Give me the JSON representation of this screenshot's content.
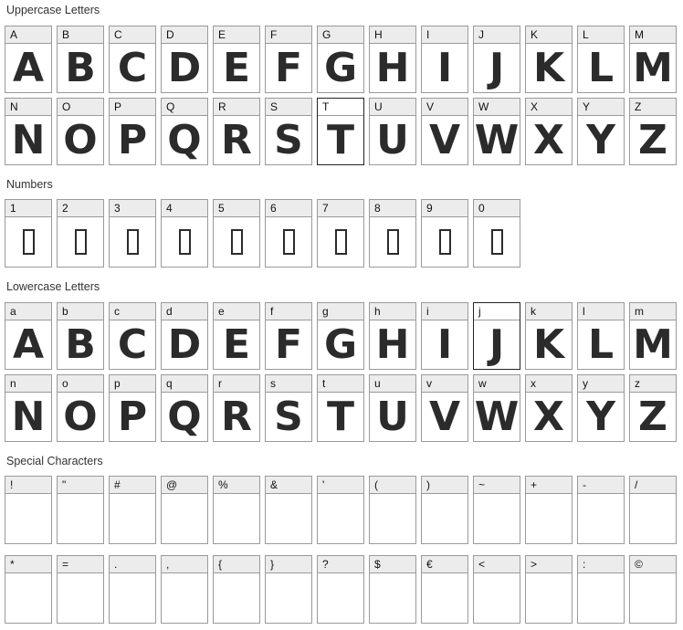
{
  "sections": [
    {
      "title": "Uppercase Letters",
      "rows": [
        [
          "A",
          "B",
          "C",
          "D",
          "E",
          "F",
          "G",
          "H",
          "I",
          "J",
          "K",
          "L",
          "M"
        ],
        [
          "N",
          "O",
          "P",
          "Q",
          "R",
          "S",
          "T",
          "U",
          "V",
          "W",
          "X",
          "Y",
          "Z"
        ]
      ],
      "glyphs": [
        [
          "A",
          "B",
          "C",
          "D",
          "E",
          "F",
          "G",
          "H",
          "I",
          "J",
          "K",
          "L",
          "M"
        ],
        [
          "N",
          "O",
          "P",
          "Q",
          "R",
          "S",
          "T",
          "U",
          "V",
          "W",
          "X",
          "Y",
          "Z"
        ]
      ],
      "focus": "T"
    },
    {
      "title": "Numbers",
      "rows": [
        [
          "1",
          "2",
          "3",
          "4",
          "5",
          "6",
          "7",
          "8",
          "9",
          "0"
        ]
      ],
      "glyphs": "notdef"
    },
    {
      "title": "Lowercase Letters",
      "rows": [
        [
          "a",
          "b",
          "c",
          "d",
          "e",
          "f",
          "g",
          "h",
          "i",
          "j",
          "k",
          "l",
          "m"
        ],
        [
          "n",
          "o",
          "p",
          "q",
          "r",
          "s",
          "t",
          "u",
          "v",
          "w",
          "x",
          "y",
          "z"
        ]
      ],
      "glyphs": [
        [
          "A",
          "B",
          "C",
          "D",
          "E",
          "F",
          "G",
          "H",
          "I",
          "J",
          "K",
          "L",
          "M"
        ],
        [
          "N",
          "O",
          "P",
          "Q",
          "R",
          "S",
          "T",
          "U",
          "V",
          "W",
          "X",
          "Y",
          "Z"
        ]
      ],
      "focus": "j"
    },
    {
      "title": "Special Characters",
      "rows": [
        [
          "!",
          "\"",
          "#",
          "@",
          "%",
          "&",
          "'",
          "(",
          ")",
          "~",
          "+",
          "-",
          "/"
        ],
        [
          "*",
          "=",
          ".",
          ",",
          "{",
          "}",
          "?",
          "$",
          "€",
          "<",
          ">",
          ":",
          "©"
        ]
      ],
      "glyphs": "empty"
    }
  ]
}
